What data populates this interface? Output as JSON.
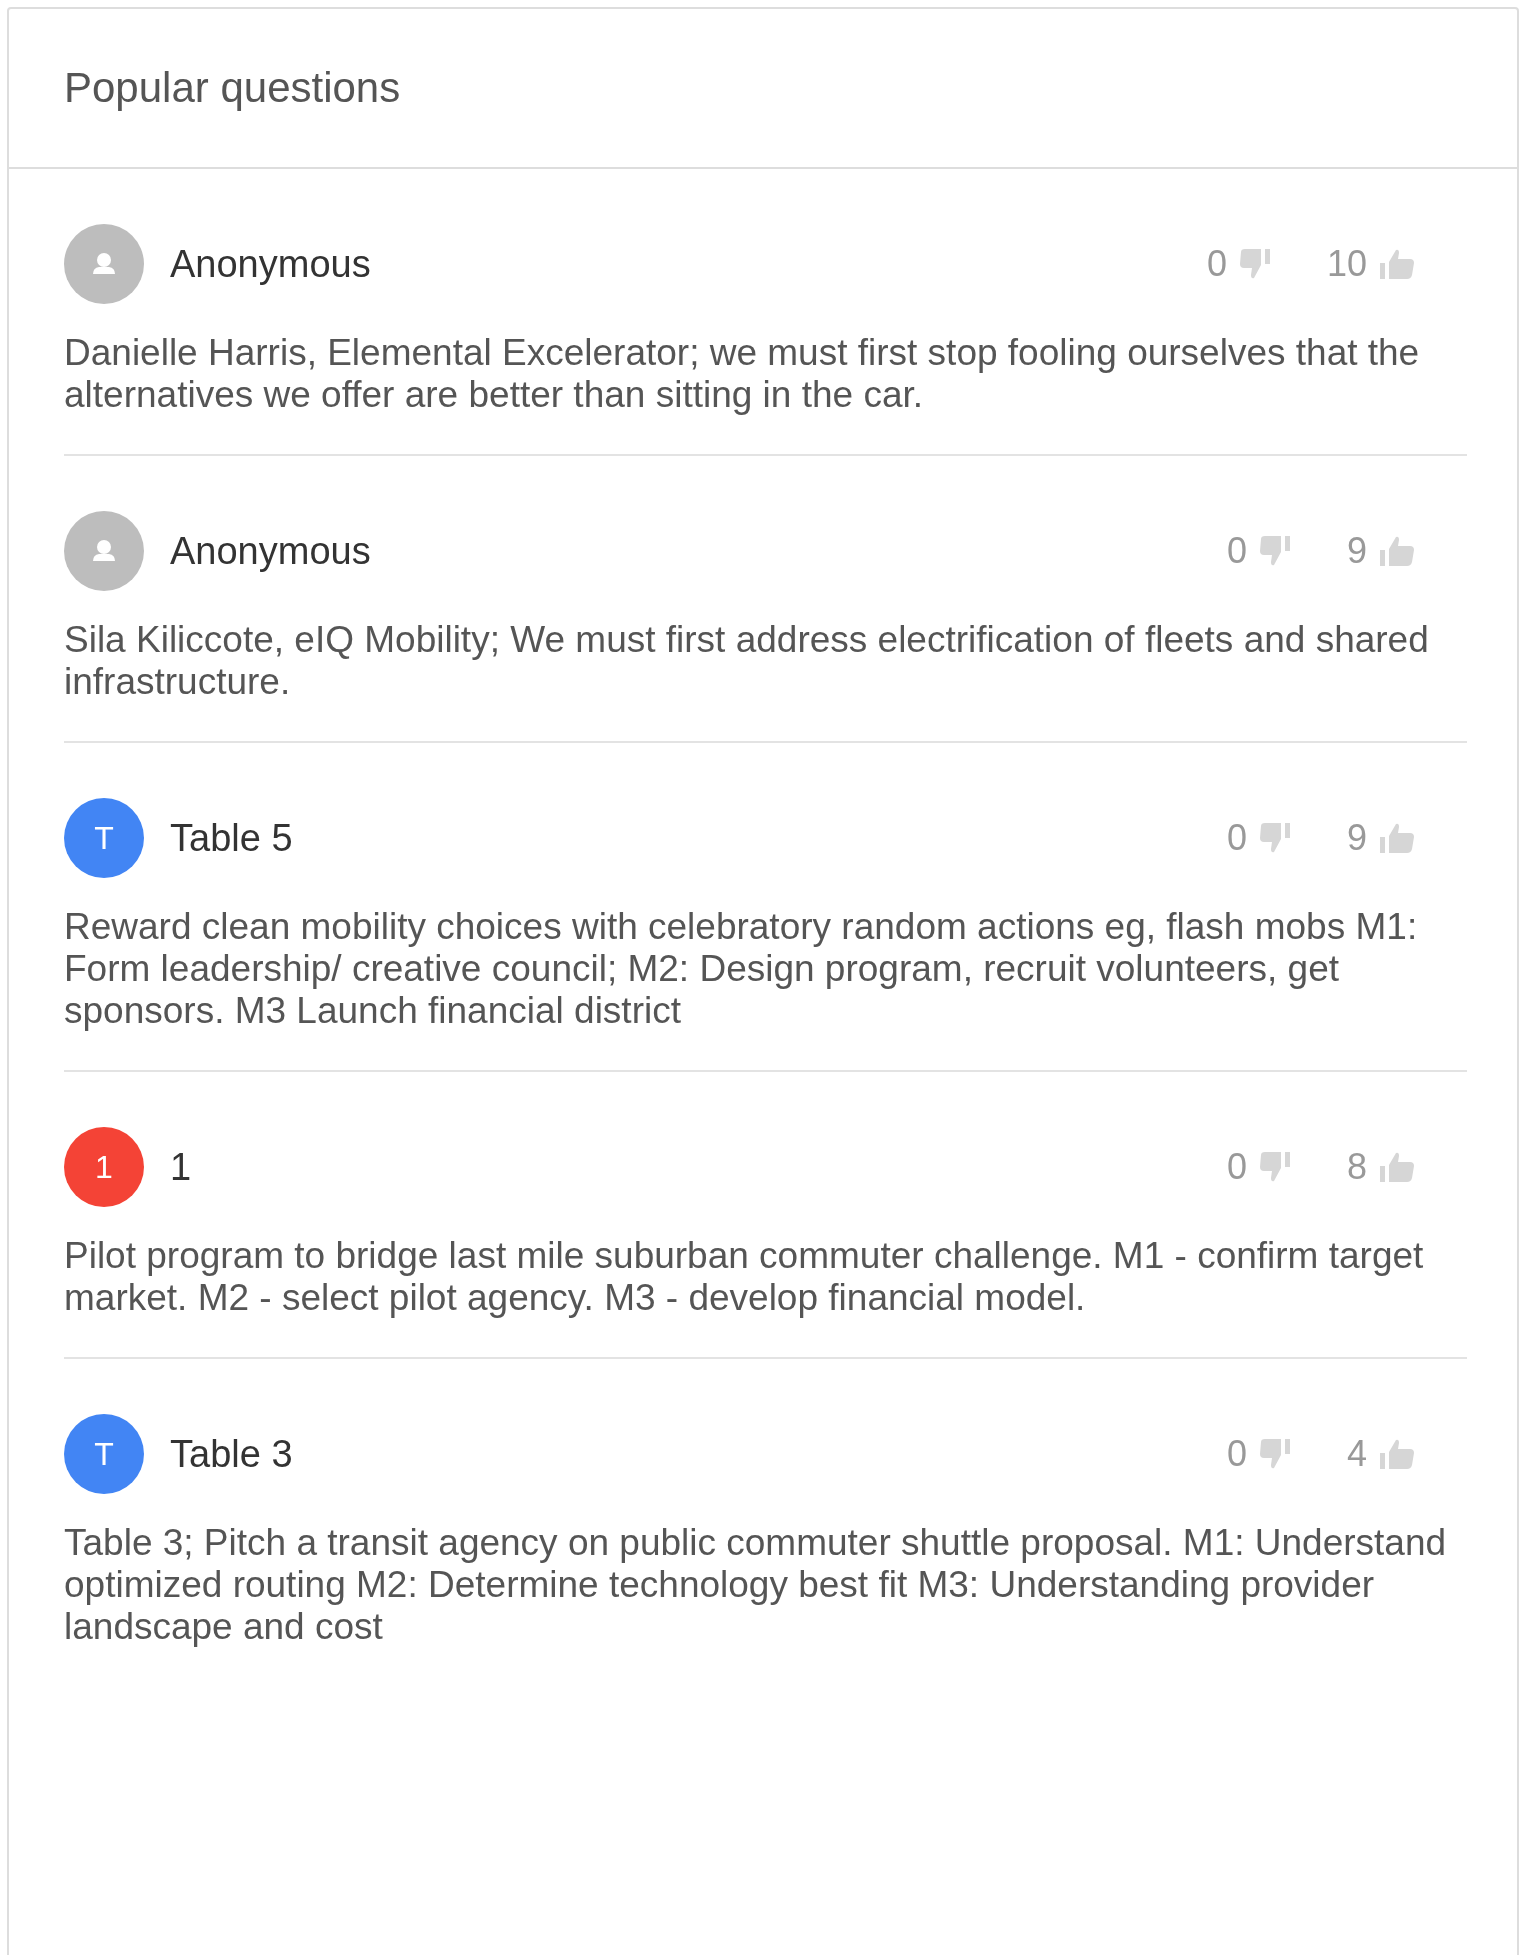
{
  "panel": {
    "title": "Popular questions"
  },
  "questions": [
    {
      "author": "Anonymous",
      "avatar": {
        "kind": "anonymous",
        "color": "#bdbdbd"
      },
      "downvotes": "0",
      "upvotes": "10",
      "text": "Danielle Harris, Elemental Excelerator; we must first stop fooling ourselves that the alternatives we offer are better than sitting in the car."
    },
    {
      "author": "Anonymous",
      "avatar": {
        "kind": "anonymous",
        "color": "#bdbdbd"
      },
      "downvotes": "0",
      "upvotes": "9",
      "text": "Sila Kiliccote, eIQ Mobility; We must first address electrification of fleets and shared infrastructure."
    },
    {
      "author": "Table 5",
      "avatar": {
        "kind": "initial",
        "letter": "T",
        "color": "#4285f4"
      },
      "downvotes": "0",
      "upvotes": "9",
      "text": "Reward clean mobility choices with celebratory random actions eg, flash mobs M1: Form leadership/ creative council; M2: Design program, recruit volunteers, get sponsors. M3 Launch financial district"
    },
    {
      "author": "1",
      "avatar": {
        "kind": "initial",
        "letter": "1",
        "color": "#f44336"
      },
      "downvotes": "0",
      "upvotes": "8",
      "text": "Pilot program to bridge last mile suburban commuter challenge. M1 - confirm target market. M2 - select pilot agency. M3 - develop financial model."
    },
    {
      "author": "Table 3",
      "avatar": {
        "kind": "initial",
        "letter": "T",
        "color": "#4285f4"
      },
      "downvotes": "0",
      "upvotes": "4",
      "text": "Table 3; Pitch a transit agency on public commuter shuttle proposal. M1: Understand optimized routing M2: Determine technology best fit M3: Understanding provider landscape and cost"
    }
  ]
}
